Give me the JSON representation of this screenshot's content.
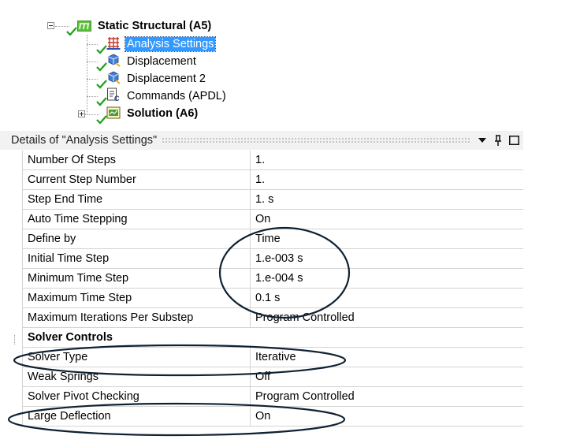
{
  "tree": {
    "root": {
      "label": "Static Structural (A5)",
      "icon": "static-structural-icon"
    },
    "children": [
      {
        "label": "Analysis Settings",
        "icon": "analysis-settings-icon",
        "selected": true
      },
      {
        "label": "Displacement",
        "icon": "displacement-icon"
      },
      {
        "label": "Displacement 2",
        "icon": "displacement-icon"
      },
      {
        "label": "Commands (APDL)",
        "icon": "commands-icon"
      }
    ],
    "solution": {
      "label": "Solution (A6)",
      "icon": "solution-icon"
    }
  },
  "details": {
    "title": "Details of \"Analysis Settings\"",
    "pin_icon": "pin-icon",
    "maximize_icon": "maximize-icon",
    "dropdown_icon": "dropdown-arrow-icon",
    "rows": [
      {
        "label": "Number Of Steps",
        "value": "1."
      },
      {
        "label": "Current Step Number",
        "value": "1."
      },
      {
        "label": "Step End Time",
        "value": "1. s"
      },
      {
        "label": "Auto Time Stepping",
        "value": "On"
      },
      {
        "label": "Define by",
        "value": "Time"
      },
      {
        "label": "Initial Time Step",
        "value": "1.e-003 s"
      },
      {
        "label": "Minimum Time Step",
        "value": "1.e-004 s"
      },
      {
        "label": "Maximum Time Step",
        "value": "0.1 s"
      },
      {
        "label": "Maximum Iterations Per Substep",
        "value": "Program Controlled"
      }
    ],
    "section": {
      "label": "Solver Controls"
    },
    "solver_rows": [
      {
        "label": "Solver Type",
        "value": "Iterative"
      },
      {
        "label": "Weak Springs",
        "value": "Off"
      },
      {
        "label": "Solver Pivot Checking",
        "value": "Program Controlled"
      },
      {
        "label": "Large Deflection",
        "value": "On"
      }
    ]
  },
  "colors": {
    "selection": "#3399ff",
    "check": "#1aa01a",
    "annotation": "#0f2233",
    "header_bg": "#f2f2f2",
    "grid_line": "#d4d4d4"
  }
}
